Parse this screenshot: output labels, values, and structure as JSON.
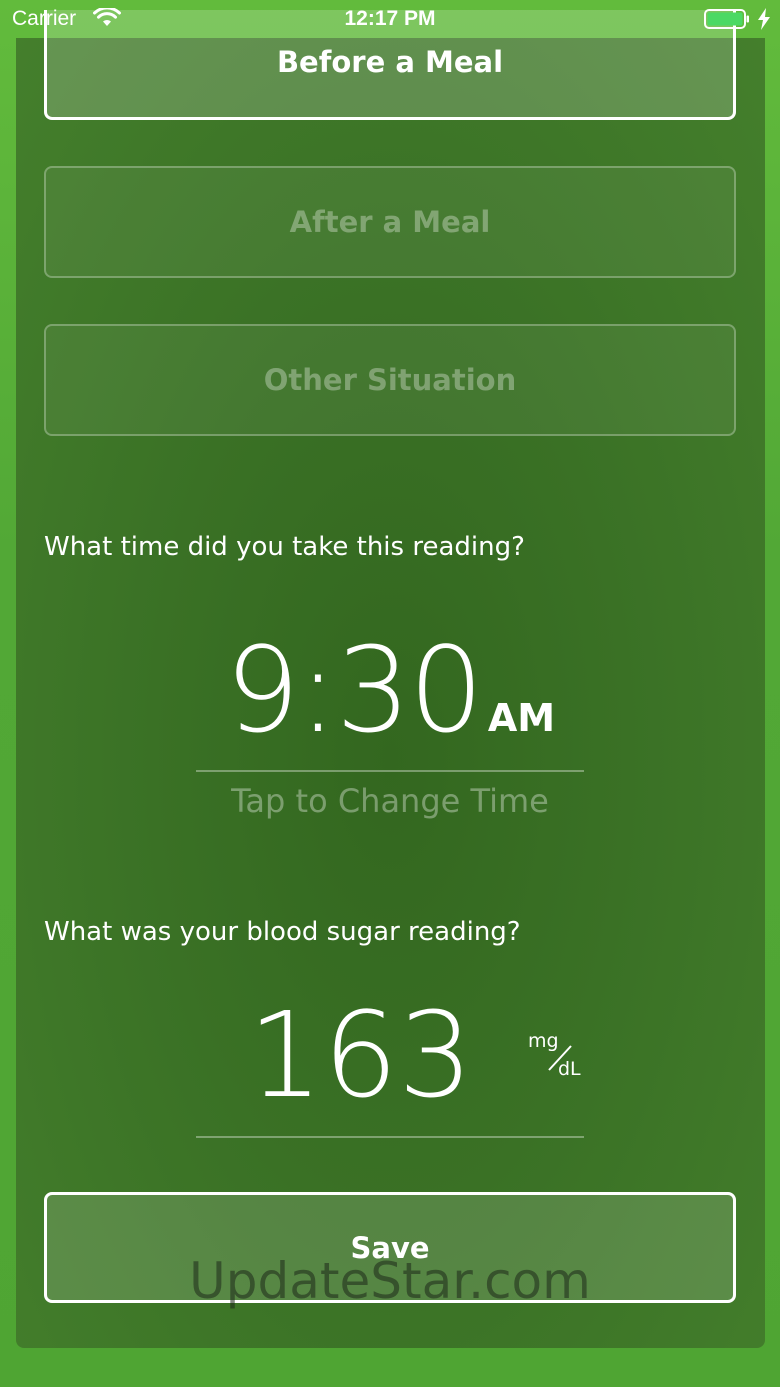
{
  "status_bar": {
    "carrier": "Carrier",
    "time": "12:17 PM"
  },
  "meal_options": {
    "before": "Before a Meal",
    "after": "After a Meal",
    "other": "Other Situation",
    "selected": "before"
  },
  "time_section": {
    "question": "What time did you take this reading?",
    "time": "9:30",
    "ampm": "AM",
    "hint": "Tap to Change Time"
  },
  "reading_section": {
    "question": "What was your blood sugar reading?",
    "value": "163",
    "unit_top": "mg",
    "unit_bottom": "dL"
  },
  "save_button": "Save",
  "watermark": "UpdateStar.com",
  "colors": {
    "outer_green": "#5ab33a",
    "card_green": "#3a7125",
    "battery_green": "#4cd964"
  }
}
